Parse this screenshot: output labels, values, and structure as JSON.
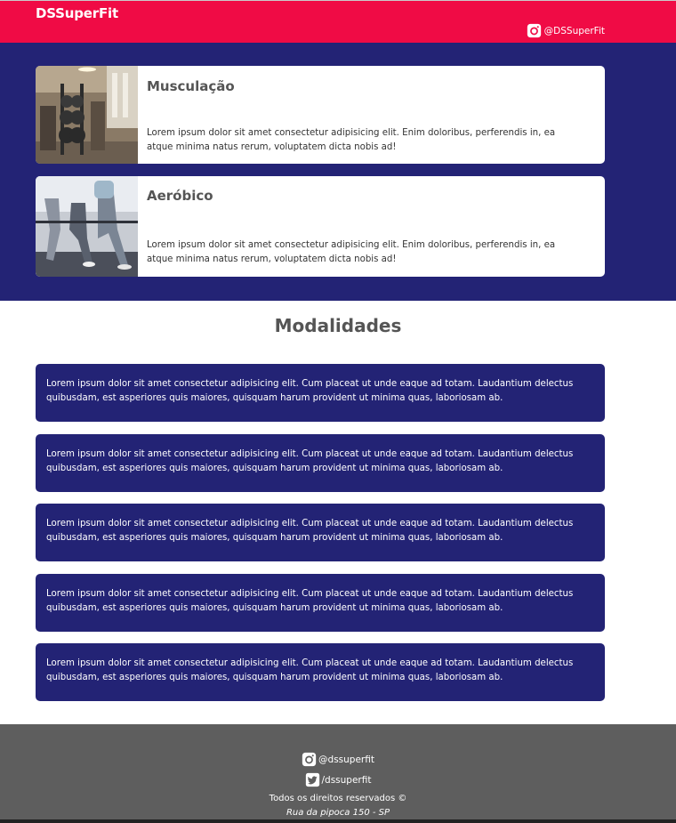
{
  "header": {
    "brand": "DSSuperFit",
    "instagram_handle": "@DSSuperFit",
    "bg_color": "#f00b45"
  },
  "hero": {
    "bg_color": "#232375",
    "cards": [
      {
        "title": "Musculação",
        "text": "Lorem ipsum dolor sit amet consectetur adipisicing elit. Enim doloribus, perferendis in, ea atque minima natus rerum, voluptatem dicta nobis ad!",
        "image": "gym-weights-photo"
      },
      {
        "title": "Aeróbico",
        "text": "Lorem ipsum dolor sit amet consectetur adipisicing elit. Enim doloribus, perferendis in, ea atque minima natus rerum, voluptatem dicta nobis ad!",
        "image": "treadmill-runners-photo"
      }
    ]
  },
  "modalidades": {
    "title": "Modalidades",
    "items": [
      "Lorem ipsum dolor sit amet consectetur adipisicing elit. Cum placeat ut unde eaque ad totam. Laudantium delectus quibusdam, est asperiores quis maiores, quisquam harum provident ut minima quas, laboriosam ab.",
      "Lorem ipsum dolor sit amet consectetur adipisicing elit. Cum placeat ut unde eaque ad totam. Laudantium delectus quibusdam, est asperiores quis maiores, quisquam harum provident ut minima quas, laboriosam ab.",
      "Lorem ipsum dolor sit amet consectetur adipisicing elit. Cum placeat ut unde eaque ad totam. Laudantium delectus quibusdam, est asperiores quis maiores, quisquam harum provident ut minima quas, laboriosam ab.",
      "Lorem ipsum dolor sit amet consectetur adipisicing elit. Cum placeat ut unde eaque ad totam. Laudantium delectus quibusdam, est asperiores quis maiores, quisquam harum provident ut minima quas, laboriosam ab.",
      "Lorem ipsum dolor sit amet consectetur adipisicing elit. Cum placeat ut unde eaque ad totam. Laudantium delectus quibusdam, est asperiores quis maiores, quisquam harum provident ut minima quas, laboriosam ab."
    ]
  },
  "footer": {
    "instagram": "@dssuperfit",
    "twitter": "/dssuperfit",
    "rights": "Todos os direitos reservados ©",
    "address": "Rua da pipoca 150 - SP",
    "bg_color": "#5e5e5e"
  }
}
